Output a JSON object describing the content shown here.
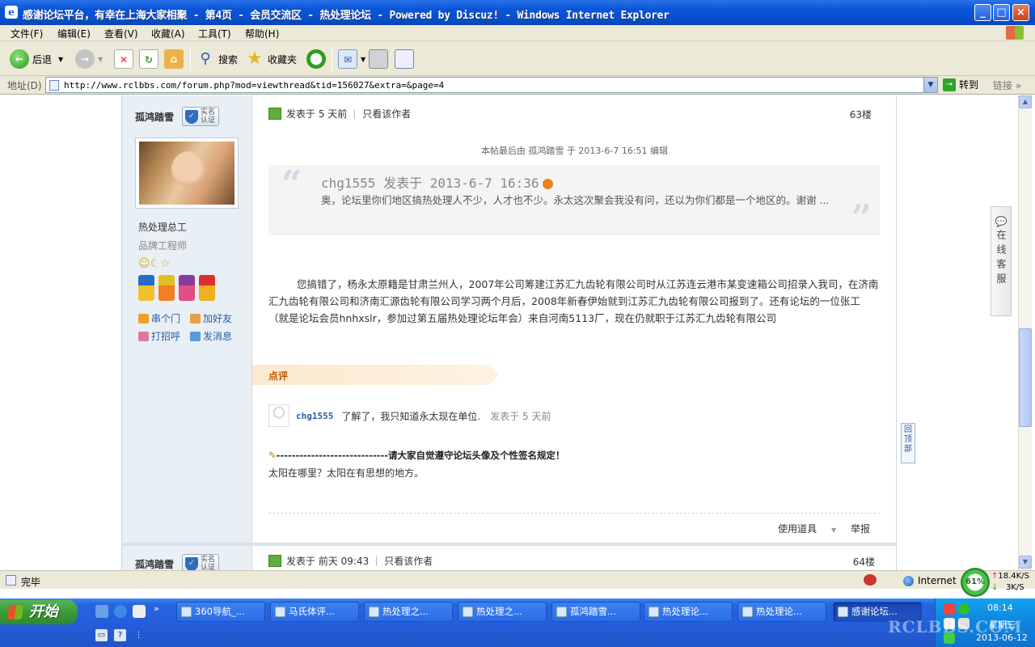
{
  "window": {
    "title": "感谢论坛平台，有幸在上海大家相聚 - 第4页 - 会员交流区 - 热处理论坛 - Powered by Discuz! - Windows Internet Explorer",
    "min": "_",
    "max": "□",
    "close": "×"
  },
  "menu": [
    "文件(F)",
    "编辑(E)",
    "查看(V)",
    "收藏(A)",
    "工具(T)",
    "帮助(H)"
  ],
  "toolbar": {
    "back": "后退",
    "search": "搜索",
    "favorites": "收藏夹"
  },
  "address": {
    "label": "地址(D)",
    "url": "http://www.rclbbs.com/forum.php?mod=viewthread&tid=156027&extra=&page=4",
    "go": "转到",
    "links": "链接"
  },
  "post": {
    "author": "孤鸿踏雪",
    "badge": "实名认证",
    "title1": "热处理总工",
    "title2": "品牌工程师",
    "links": [
      "串个门",
      "加好友",
      "打招呼",
      "发消息"
    ],
    "time_prefix": "发表于",
    "time": "5 天前",
    "only_author": "只看该作者",
    "floor": "63楼",
    "edit_note": "本帖最后由 孤鸿踏雪 于 2013-6-7 16:51 编辑",
    "quote_head": "chg1555 发表于 2013-6-7 16:36",
    "quote_body": "奥，论坛里你们地区搞热处理人不少，人才也不少。永太这次聚会我没有问，还以为你们都是一个地区的。谢谢 ...",
    "body": "您搞错了，杨永太原籍是甘肃兰州人，2007年公司筹建江苏汇九齿轮有限公司时从江苏连云港市某变速箱公司招录入我司，在济南汇九齿轮有限公司和济南汇源齿轮有限公司学习两个月后，2008年新春伊始就到江苏汇九齿轮有限公司报到了。还有论坛的一位张工（就是论坛会员hnhxslr，参加过第五届热处理论坛年会）来自河南5113厂，现在仍就职于江苏汇九齿轮有限公司",
    "rate_label": "点评",
    "comment": {
      "user": "chg1555",
      "text": "了解了，我只知道永太现在单位.",
      "time": "发表于 5 天前"
    },
    "sig1": "-----------------------------请大家自觉遵守论坛头像及个性签名规定！",
    "sig2": "太阳在哪里？太阳在有思想的地方。",
    "actions": [
      "使用道具",
      "举报"
    ]
  },
  "next_post": {
    "author": "孤鸿踏雪",
    "time_prefix": "发表于",
    "time": "前天 09:43",
    "only_author": "只看该作者",
    "floor": "64楼"
  },
  "float": {
    "back_top": "回顶部",
    "kefu": "在线客服"
  },
  "status": {
    "text": "完毕",
    "zone": "Internet",
    "gauge": "61%",
    "up": "18.4K/S",
    "down": "3K/S"
  },
  "taskbar": {
    "start": "开始",
    "tasks": [
      "360导航_...",
      "马氏体评...",
      "热处理之...",
      "热处理之...",
      "孤鸿踏雪...",
      "热处理论...",
      "热处理论...",
      "感谢论坛..."
    ],
    "time": "08:14",
    "weekday": "星期三",
    "date": "2013-06-12"
  },
  "watermark": "RCLBBS.COM"
}
